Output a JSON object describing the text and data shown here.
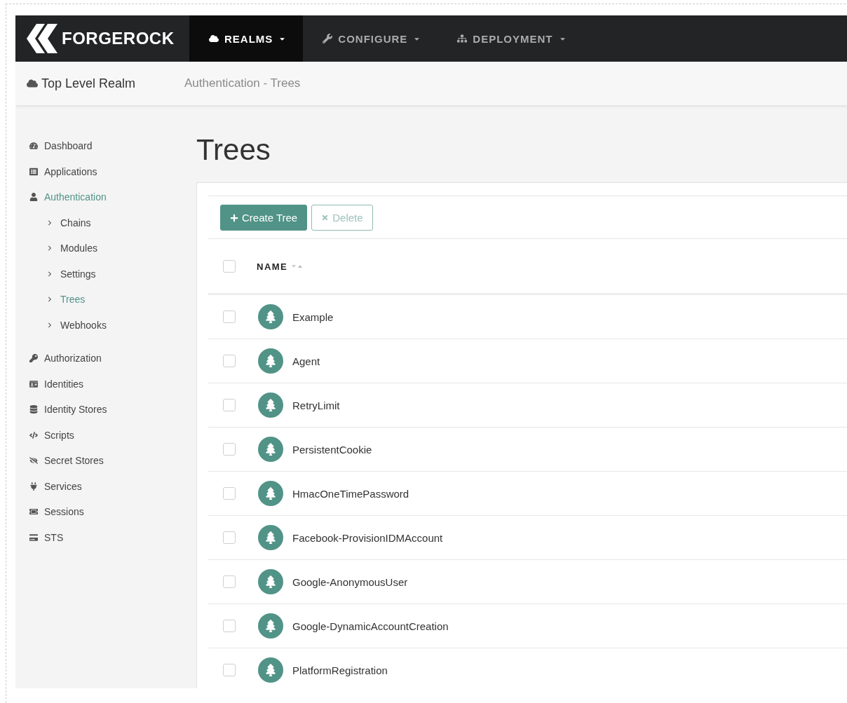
{
  "brand": "FORGEROCK",
  "nav": [
    {
      "label": "REALMS",
      "selected": true
    },
    {
      "label": "CONFIGURE",
      "selected": false
    },
    {
      "label": "DEPLOYMENT",
      "selected": false
    }
  ],
  "realm": "Top Level Realm",
  "breadcrumb": "Authentication - Trees",
  "sidebar": {
    "items": [
      {
        "label": "Dashboard",
        "selected": false
      },
      {
        "label": "Applications",
        "selected": false
      },
      {
        "label": "Authentication",
        "selected": true,
        "children": [
          {
            "label": "Chains",
            "selected": false
          },
          {
            "label": "Modules",
            "selected": false
          },
          {
            "label": "Settings",
            "selected": false
          },
          {
            "label": "Trees",
            "selected": true
          },
          {
            "label": "Webhooks",
            "selected": false
          }
        ]
      },
      {
        "label": "Authorization",
        "selected": false
      },
      {
        "label": "Identities",
        "selected": false
      },
      {
        "label": "Identity Stores",
        "selected": false
      },
      {
        "label": "Scripts",
        "selected": false
      },
      {
        "label": "Secret Stores",
        "selected": false
      },
      {
        "label": "Services",
        "selected": false
      },
      {
        "label": "Sessions",
        "selected": false
      },
      {
        "label": "STS",
        "selected": false
      }
    ]
  },
  "page_title": "Trees",
  "toolbar": {
    "create": "Create Tree",
    "delete": {
      "label": "Delete",
      "disabled": true
    }
  },
  "table": {
    "columns": [
      "NAME"
    ],
    "all_checked": false,
    "rows": [
      {
        "name": "Example",
        "checked": false
      },
      {
        "name": "Agent",
        "checked": false
      },
      {
        "name": "RetryLimit",
        "checked": false
      },
      {
        "name": "PersistentCookie",
        "checked": false
      },
      {
        "name": "HmacOneTimePassword",
        "checked": false
      },
      {
        "name": "Facebook-ProvisionIDMAccount",
        "checked": false
      },
      {
        "name": "Google-AnonymousUser",
        "checked": false
      },
      {
        "name": "Google-DynamicAccountCreation",
        "checked": false
      },
      {
        "name": "PlatformRegistration",
        "checked": false
      }
    ]
  }
}
